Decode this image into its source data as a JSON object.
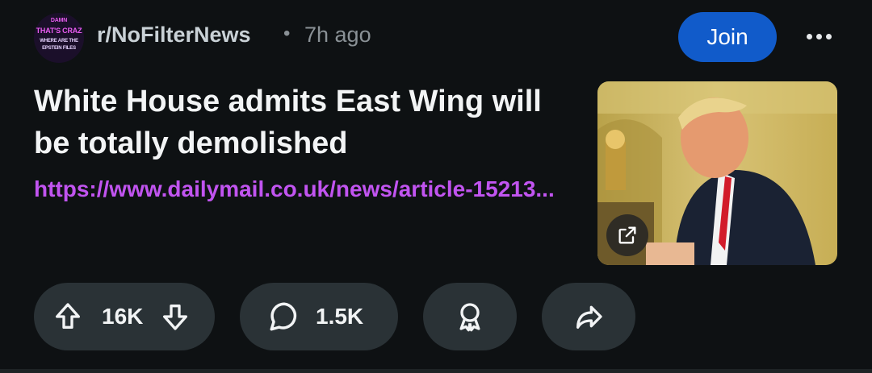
{
  "post": {
    "subreddit": "r/NoFilterNews",
    "time_ago": "7h ago",
    "separator": "•",
    "join_label": "Join",
    "title": "White House admits East Wing will be totally demolished",
    "link": "https://www.dailymail.co.uk/news/article-15213...",
    "avatar_text": [
      "DAMN",
      "THAT'S CRAZ",
      "WHERE ARE THE",
      "EPSTEIN FILES"
    ]
  },
  "actions": {
    "upvotes": "16K",
    "comments": "1.5K"
  },
  "colors": {
    "background": "#0e1113",
    "join_button": "#115bca",
    "link": "#c154f0",
    "pill": "#2a3236"
  },
  "icons": [
    "more-options-icon",
    "external-link-icon",
    "upvote-icon",
    "downvote-icon",
    "comment-icon",
    "award-icon",
    "share-icon"
  ]
}
